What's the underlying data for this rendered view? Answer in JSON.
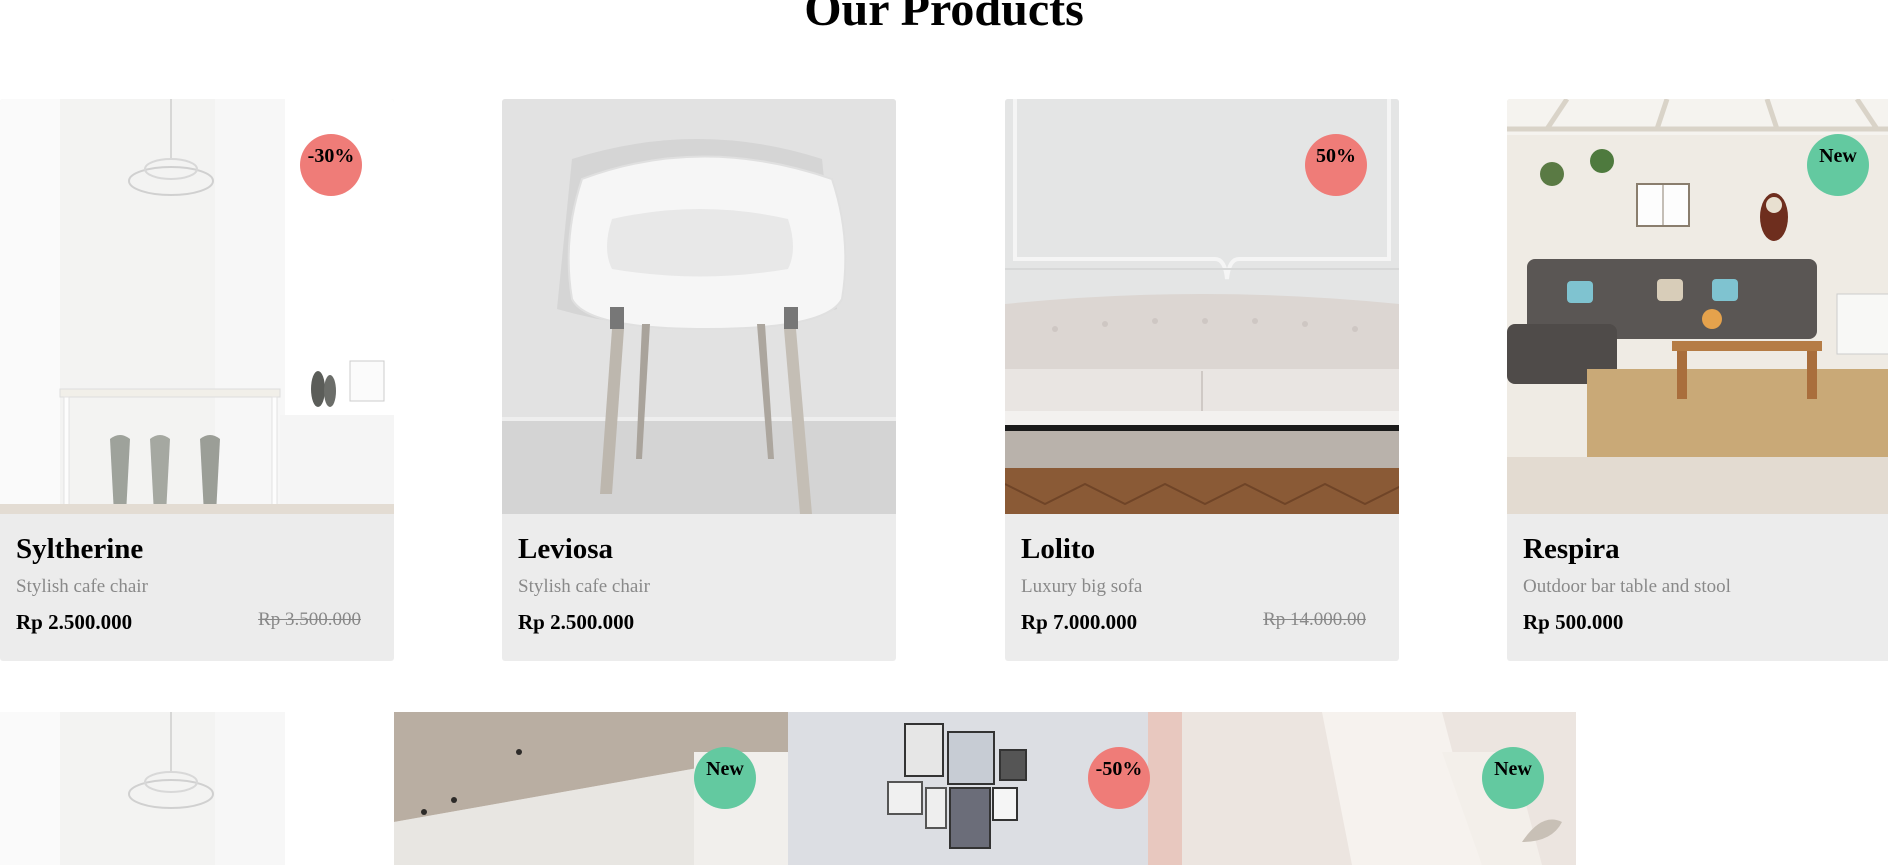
{
  "heading": "Our Products",
  "products": [
    {
      "name": "Syltherine",
      "description": "Stylish cafe chair",
      "price": "Rp 2.500.000",
      "old_price": "Rp 3.500.000",
      "badge": "-30%",
      "badge_type": "sale"
    },
    {
      "name": "Leviosa",
      "description": "Stylish cafe chair",
      "price": "Rp 2.500.000",
      "old_price": "",
      "badge": "",
      "badge_type": ""
    },
    {
      "name": "Lolito",
      "description": "Luxury big sofa",
      "price": "Rp 7.000.000",
      "old_price": "Rp 14.000.00",
      "badge": "50%",
      "badge_type": "sale"
    },
    {
      "name": "Respira",
      "description": "Outdoor bar table and stool",
      "price": "Rp 500.000",
      "old_price": "",
      "badge": "New",
      "badge_type": "new"
    }
  ],
  "second_row": [
    {
      "badge": "",
      "badge_type": ""
    },
    {
      "badge": "New",
      "badge_type": "new"
    },
    {
      "badge": "-50%",
      "badge_type": "sale"
    },
    {
      "badge": "New",
      "badge_type": "new"
    }
  ],
  "colors": {
    "sale_badge": "#ef7c78",
    "new_badge": "#63c9a0",
    "card_bg": "#ececec",
    "muted_text": "#898989"
  }
}
